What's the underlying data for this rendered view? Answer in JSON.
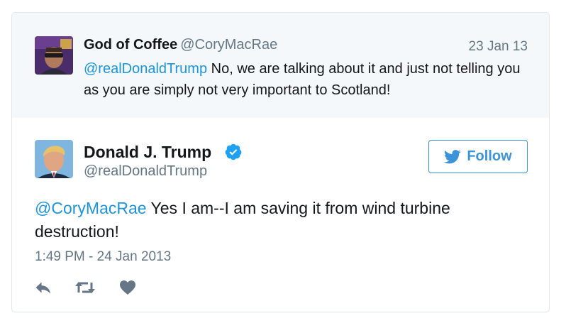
{
  "parent_tweet": {
    "display_name": "God of Coffee",
    "handle": "@CoryMacRae",
    "date": "23 Jan 13",
    "mention": "@realDonaldTrump",
    "text": " No, we are talking about it and just not telling you as you are simply not very important to Scotland!"
  },
  "main_tweet": {
    "display_name": "Donald J. Trump",
    "handle": "@realDonaldTrump",
    "verified": true,
    "follow_label": "Follow",
    "mention": "@CoryMacRae",
    "text": " Yes I am--I am saving it from wind turbine destruction!",
    "timestamp": "1:49 PM - 24 Jan 2013"
  },
  "icons": {
    "reply": "reply-icon",
    "retweet": "retweet-icon",
    "like": "heart-icon",
    "follow": "twitter-bird-icon",
    "verified": "verified-badge-icon"
  },
  "colors": {
    "accent": "#1b95e0",
    "follow_border": "#3b94d9",
    "muted_text": "#657786",
    "action_icon": "#657786",
    "parent_background": "#f5f8fa"
  }
}
